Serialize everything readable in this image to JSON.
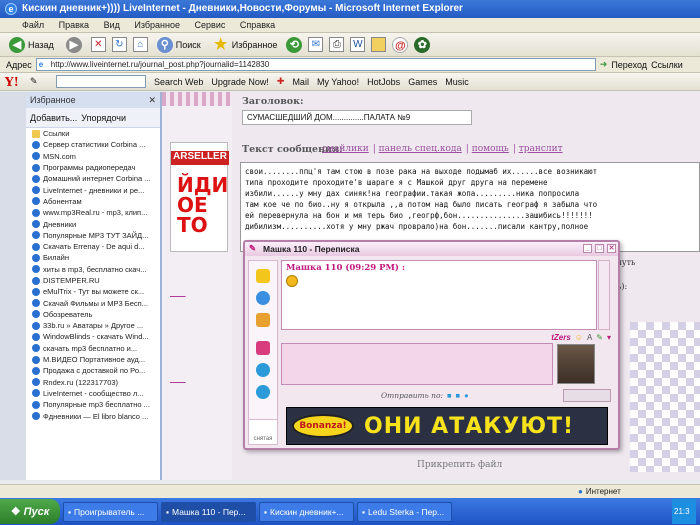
{
  "window": {
    "title": "Кискин дневник+)))) LiveInternet - Дневники,Новости,Форумы - Microsoft Internet Explorer"
  },
  "menu": [
    "Файл",
    "Правка",
    "Вид",
    "Избранное",
    "Сервис",
    "Справка"
  ],
  "toolbar": {
    "back": "Назад",
    "search": "Поиск",
    "favorites": "Избранное"
  },
  "address": {
    "label": "Адрес",
    "url": "http://www.liveinternet.ru/journal_post.php?journalid=1142830",
    "go": "Переход",
    "links": "Ссылки"
  },
  "yahoo_toolbar": {
    "search_web": "Search Web",
    "upgrade": "Upgrade Now!",
    "mail": "Mail",
    "my_yahoo": "My Yahoo!",
    "hotjobs": "HotJobs",
    "games": "Games",
    "music": "Music"
  },
  "favorites_panel": {
    "title": "Избранное",
    "add": "Добавить...",
    "organize": "Упорядочи",
    "items": [
      {
        "label": "Ссылки",
        "folder": true
      },
      {
        "label": "Сервер статистики Corbina ...",
        "folder": false
      },
      {
        "label": "MSN.com",
        "folder": false
      },
      {
        "label": "Программы радиопередач",
        "folder": false
      },
      {
        "label": "Домашний интернет Corbina ...",
        "folder": false
      },
      {
        "label": "LiveInternet - дневники и ре...",
        "folder": false
      },
      {
        "label": "Абонентам",
        "folder": false
      },
      {
        "label": "www.mp3Real.ru - mp3, клип...",
        "folder": false
      },
      {
        "label": "Дневники",
        "folder": false
      },
      {
        "label": "Популярные MP3 ТУТ ЗАЙД...",
        "folder": false
      },
      {
        "label": "Скачать Errenay - De aqui d...",
        "folder": false
      },
      {
        "label": "Билайн",
        "folder": false
      },
      {
        "label": "хиты в mp3, бесплатно скач...",
        "folder": false
      },
      {
        "label": "DISTEMPER.RU",
        "folder": false
      },
      {
        "label": "eMulTrix - Тут вы можете ск...",
        "folder": false
      },
      {
        "label": "Скачай Фильмы и MP3 Бесп...",
        "folder": false
      },
      {
        "label": "Обозреватель",
        "folder": false
      },
      {
        "label": "33b.ru » Аватары » Другое ...",
        "folder": false
      },
      {
        "label": "WindowBlinds - скачать Wind...",
        "folder": false
      },
      {
        "label": "скачать mp3 бесплатно и...",
        "folder": false
      },
      {
        "label": "M.ВИДЕО Портативное ауд...",
        "folder": false
      },
      {
        "label": "Продажа с доставкой по Ро...",
        "folder": false
      },
      {
        "label": "Rndex.ru (122317703)",
        "folder": false
      },
      {
        "label": "LiveInternet - сообщество л...",
        "folder": false
      },
      {
        "label": "Популярные mp3 бесплатно ...",
        "folder": false
      },
      {
        "label": "Фдневники — El libro blanco ...",
        "folder": false
      }
    ]
  },
  "post_form": {
    "title_label": "Заголовок:",
    "title_value": "СУМАСШЕДШИЙ ДОМ..............ПАЛАТА №9",
    "text_label": "Текст сообщения:",
    "tools": [
      "смайлики",
      "панель спец.кода",
      "помощь",
      "транслит"
    ],
    "message": "свои........ппц'я там стою в позе рака на выходе подымаб их......все возникают\nтипа проходите проходите'в шараге я с Машкой друг друга на перемене\nизбили......у мну дах синяк!на географии.такая жопа.........ника попросила\nтам кое че по био..ну я открыла ,,а потом над было писать географ я забыла что\nей перевернула на бон и мя терь био ,геогрф,бон...............зашибись!!!!!!!\nдибилизм..........хотя у мну ржач проврало)на бон.......писали кантру,полное",
    "attach_label": "Прикрепить файл",
    "side_note": "я чуть",
    "side_note2": "ь):"
  },
  "ad": {
    "brand": "ARSELLER",
    "big_text": "ЙДИ\nОЕ\nТО"
  },
  "chat": {
    "title": "Машка 110 - Переписка",
    "message_meta": "Машка 110 (09:29 PM) :",
    "zers": "tZers",
    "send_label": "Отправить по:",
    "banner_brand": "Bonanza!",
    "banner_text": "ОНИ АТАКУЮТ!",
    "bottom_left": "снятая"
  },
  "status": {
    "zone": "Интернет"
  },
  "taskbar": {
    "start": "Пуск",
    "tasks": [
      {
        "label": "Проигрыватель ...",
        "active": false
      },
      {
        "label": "Машка 110 - Пер...",
        "active": true
      },
      {
        "label": "Кискин дневник+...",
        "active": false
      },
      {
        "label": "Ledu Sterka - Пер...",
        "active": false
      }
    ],
    "clock": "21:3"
  }
}
